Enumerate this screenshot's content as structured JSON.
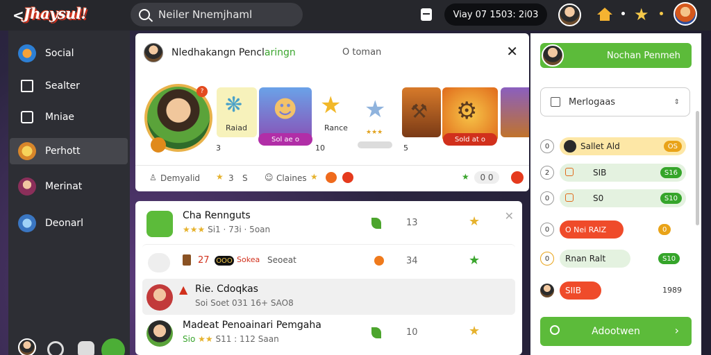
{
  "app": {
    "back_glyph": "<",
    "logo": "Jhaysul!"
  },
  "search": {
    "placeholder": "Neiler Nnemjhaml"
  },
  "clock": {
    "text": "Viay  07  1503: 2i03"
  },
  "sidebar": {
    "items": [
      {
        "label": "Social",
        "icon": "globe-icon"
      },
      {
        "label": "Sealter",
        "icon": "envelope-icon"
      },
      {
        "label": "Mniae",
        "icon": "square-icon"
      },
      {
        "label": "Perhott",
        "icon": "badge-icon",
        "active": true
      },
      {
        "label": "Merinat",
        "icon": "avatar-icon"
      },
      {
        "label": "Deonarl",
        "icon": "planet-icon"
      }
    ]
  },
  "profile_card": {
    "name_part1": "Nledhakangn Pencl",
    "name_part2": "aringn",
    "status": "O toman",
    "avatar_badge": "?",
    "tile1_label": "Raiad",
    "tile3_label": "Rance",
    "tile2_pill": "Sol ae o",
    "tile5_pill": "Sold at o",
    "count1": "3",
    "count2": "10",
    "count3": "5",
    "foot": {
      "left": "Demyalid",
      "mid1": "3",
      "mid2": "S",
      "chat": "Claines",
      "right1": "0",
      "right2": "0"
    }
  },
  "list": {
    "rows": [
      {
        "title": "Cha Rennguts",
        "sub": "Si1 · 73i · 5oan",
        "num": "13"
      },
      {
        "title": "27",
        "sub": "Seoeat",
        "badge_black": "OOO",
        "badge_text": "Sokea",
        "num": "34"
      },
      {
        "title": "Rie. Cdoqkas",
        "sub": "Soi  Soet 031  16+  SAO8",
        "num": ""
      },
      {
        "title": "Madeat Penoainari Pemgaha",
        "sub": "S11 : 112 Saan",
        "badge_green": "Sio",
        "num": "10"
      }
    ]
  },
  "right_panel": {
    "top_button": "Nochan Penmeh",
    "dropdown": "Merlogaas",
    "rows": [
      {
        "circle": "0",
        "label": "Sallet Ald",
        "badge": "OS",
        "color": "#fde7a6"
      },
      {
        "circle": "2",
        "label": "SIB",
        "badge": "S16",
        "color": "#e4f2e0"
      },
      {
        "circle": "0",
        "label": "S0",
        "badge": "S10",
        "color": "#e4f2e0"
      },
      {
        "circle": "0",
        "label": "O Nei RAIZ",
        "badge": "0",
        "color": "#ef4b2a"
      },
      {
        "circle": "0",
        "label": "Rnan Ralt",
        "badge": "S10",
        "color": "#e4f2e0"
      },
      {
        "circle": "",
        "label": "SIIB",
        "badge": "1989",
        "color": "#ffffff"
      }
    ],
    "action_button": "Adootwen"
  },
  "colors": {
    "accent_green": "#5cbb3a",
    "topbar": "#26272c",
    "sidebar": "#2d2e34"
  }
}
